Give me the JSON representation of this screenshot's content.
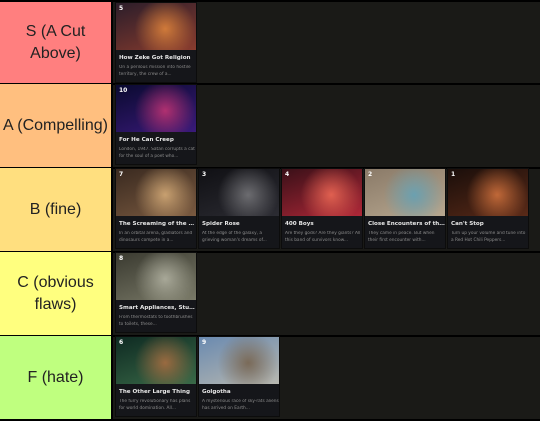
{
  "tiers": [
    {
      "label": "S (A Cut Above)",
      "color": "#ff7f7f",
      "items": [
        {
          "ep": "5",
          "title": "How Zeke Got Religion",
          "desc": "On a perilous mission into hostile territory, the crew of a...",
          "palette": [
            "#2b1d2a",
            "#8a3c2e",
            "#d07a3a"
          ]
        }
      ]
    },
    {
      "label": "A (Compelling)",
      "color": "#ffbf7f",
      "items": [
        {
          "ep": "10",
          "title": "For He Can Creep",
          "desc": "London, 1947. Satan corrupts a cat for the soul of a poet who...",
          "palette": [
            "#0a0a30",
            "#3a1a7a",
            "#b03070"
          ]
        }
      ]
    },
    {
      "label": "B (fine)",
      "color": "#ffdf7f",
      "items": [
        {
          "ep": "7",
          "title": "The Screaming of the T...",
          "desc": "In an orbital arena, gladiators and dinosaurs compete in a...",
          "palette": [
            "#3a2a20",
            "#7a5a40",
            "#c8a070"
          ]
        },
        {
          "ep": "3",
          "title": "Spider Rose",
          "desc": "At the edge of the galaxy, a grieving woman's dreams of...",
          "palette": [
            "#101014",
            "#2c2c33",
            "#6c6c70"
          ]
        },
        {
          "ep": "4",
          "title": "400 Boys",
          "desc": "Are they gods? Are they giants? All this band of survivors know...",
          "palette": [
            "#3a1018",
            "#b02838",
            "#e06050"
          ]
        },
        {
          "ep": "2",
          "title": "Close Encounters of the...",
          "desc": "They came in peace. But when their first encounter with...",
          "palette": [
            "#8a7a68",
            "#b8a890",
            "#6ba0b0"
          ]
        },
        {
          "ep": "1",
          "title": "Can't Stop",
          "desc": "Turn up your volume and tune into a Red Hot Chili Peppers...",
          "palette": [
            "#1a0e0a",
            "#5a2a18",
            "#c06838"
          ]
        }
      ]
    },
    {
      "label": "C (obvious flaws)",
      "color": "#ffff7f",
      "items": [
        {
          "ep": "8",
          "title": "Smart Appliances, Stup...",
          "desc": "From thermostats to toothbrushes to toilets, these...",
          "palette": [
            "#3a3a30",
            "#7a7a68",
            "#a8a898"
          ]
        }
      ]
    },
    {
      "label": "F (hate)",
      "color": "#bfff7f",
      "items": [
        {
          "ep": "6",
          "title": "The Other Large Thing",
          "desc": "The furry revolutionary has plans for world domination. All...",
          "palette": [
            "#0e2a22",
            "#3a6a48",
            "#9a6a40"
          ]
        },
        {
          "ep": "9",
          "title": "Golgotha",
          "desc": "A mysterious race of sky-rats aliens has arrived on Earth...",
          "palette": [
            "#6a8ab0",
            "#b8b8b0",
            "#7a6a58"
          ]
        }
      ]
    }
  ]
}
